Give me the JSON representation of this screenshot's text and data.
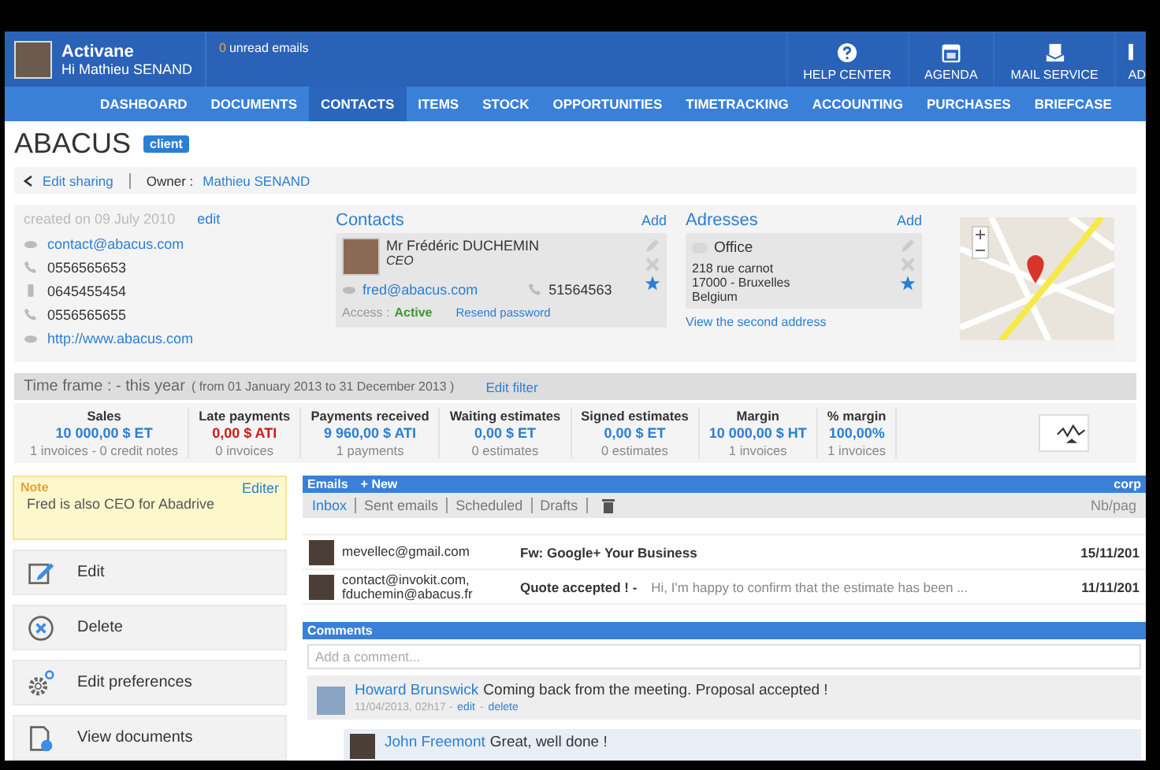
{
  "header": {
    "app_name": "Activane",
    "greeting": "Hi Mathieu SENAND",
    "unread_count": "0",
    "unread_label": "unread emails",
    "shortcuts": [
      {
        "label": "HELP CENTER",
        "kind": "help"
      },
      {
        "label": "AGENDA",
        "kind": "calendar"
      },
      {
        "label": "MAIL SERVICE",
        "kind": "mail"
      },
      {
        "label": "AD",
        "kind": "cut"
      }
    ]
  },
  "nav": [
    {
      "label": "DASHBOARD",
      "selected": false
    },
    {
      "label": "DOCUMENTS",
      "selected": false
    },
    {
      "label": "CONTACTS",
      "selected": true
    },
    {
      "label": "ITEMS",
      "selected": false
    },
    {
      "label": "STOCK",
      "selected": false
    },
    {
      "label": "OPPORTUNITIES",
      "selected": false
    },
    {
      "label": "TIMETRACKING",
      "selected": false
    },
    {
      "label": "ACCOUNTING",
      "selected": false
    },
    {
      "label": "PURCHASES",
      "selected": false
    },
    {
      "label": "BRIEFCASE",
      "selected": false
    }
  ],
  "company": {
    "name": "ABACUS",
    "badge": "client"
  },
  "sharing": {
    "link": "Edit sharing",
    "owner_label": "Owner :",
    "owner": "Mathieu SENAND"
  },
  "details": {
    "created": "created on 09 July 2010",
    "edit": "edit",
    "lines": [
      {
        "kind": "email",
        "text": "contact@abacus.com"
      },
      {
        "kind": "phone",
        "text": "0556565653"
      },
      {
        "kind": "mobile",
        "text": "0645455454"
      },
      {
        "kind": "phone",
        "text": "0556565655"
      },
      {
        "kind": "web",
        "text": "http://www.abacus.com"
      }
    ]
  },
  "contacts": {
    "title": "Contacts",
    "add": "Add",
    "name": "Mr Frédéric DUCHEMIN",
    "role": "CEO",
    "email": "fred@abacus.com",
    "phone": "51564563",
    "access_label": "Access :",
    "access": "Active",
    "resend": "Resend password",
    "favorite": true
  },
  "addresses": {
    "title": "Adresses",
    "add": "Add",
    "label": "Office",
    "lines": [
      "218 rue carnot",
      "17000 - Bruxelles",
      "Belgium"
    ],
    "favorite": true,
    "more": "View the second address"
  },
  "timeframe": {
    "label": "Time frame : - this year",
    "range": "( from 01 January 2013 to 31 December 2013 )",
    "filter": "Edit filter"
  },
  "stats": [
    {
      "title": "Sales",
      "value": "10 000,00 $ ET",
      "note": "1 invoices - 0 credit notes",
      "color": "#2a7fd4"
    },
    {
      "title": "Late payments",
      "value": "0,00 $ ATI",
      "note": "0 invoices",
      "color": "#d01a1a"
    },
    {
      "title": "Payments received",
      "value": "9 960,00 $ ATI",
      "note": "1 payments",
      "color": "#2a7fd4"
    },
    {
      "title": "Waiting estimates",
      "value": "0,00 $ ET",
      "note": "0 estimates",
      "color": "#2a7fd4"
    },
    {
      "title": "Signed estimates",
      "value": "0,00 $ ET",
      "note": "0 estimates",
      "color": "#2a7fd4"
    },
    {
      "title": "Margin",
      "value": "10 000,00 $ HT",
      "note": "1 invoices",
      "color": "#2a7fd4"
    },
    {
      "title": "% margin",
      "value": "100,00%",
      "note": "1 invoices",
      "color": "#2a7fd4"
    }
  ],
  "note": {
    "title": "Note",
    "edit": "Editer",
    "text": "Fred is also CEO for Abadrive"
  },
  "actions": [
    {
      "label": "Edit",
      "kind": "edit"
    },
    {
      "label": "Delete",
      "kind": "delete"
    },
    {
      "label": "Edit preferences",
      "kind": "prefs"
    },
    {
      "label": "View documents",
      "kind": "docs"
    }
  ],
  "emails": {
    "title": "Emails",
    "new": "+ New",
    "account": "corp",
    "per_page": "Nb/pag",
    "tabs": [
      {
        "label": "Inbox",
        "selected": true
      },
      {
        "label": "Sent emails",
        "selected": false
      },
      {
        "label": "Scheduled",
        "selected": false
      },
      {
        "label": "Drafts",
        "selected": false
      }
    ],
    "rows": [
      {
        "from": [
          "mevellec@gmail.com"
        ],
        "subject": "Fw: Google+ Your Business",
        "date": "15/11/201"
      },
      {
        "from": [
          "contact@invokit.com,",
          "fduchemin@abacus.fr"
        ],
        "subject": "Quote accepted ! -",
        "preview": "Hi,  I'm happy to confirm that the estimate has been ...",
        "date": "11/11/201"
      }
    ]
  },
  "comments": {
    "title": "Comments",
    "placeholder": "Add a comment...",
    "items": [
      {
        "author": "Howard Brunswick",
        "text": "Coming back from the meeting. Proposal accepted !",
        "meta": "11/04/2013, 02h17 -",
        "edit": "edit",
        "separator": "-",
        "delete": "delete"
      }
    ],
    "reply": {
      "author": "John Freemont",
      "text": "Great, well done !"
    }
  }
}
